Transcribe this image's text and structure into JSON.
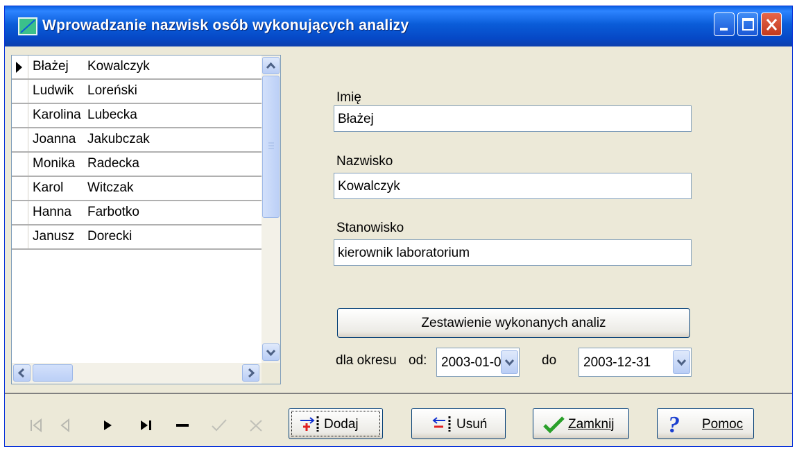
{
  "window": {
    "title": "Wprowadzanie nazwisk osób wykonujących analizy"
  },
  "grid": {
    "rows": [
      {
        "first": "Błażej",
        "last": "Kowalczyk",
        "current": true
      },
      {
        "first": "Ludwik",
        "last": "Loreński"
      },
      {
        "first": "Karolina",
        "last": "Lubecka"
      },
      {
        "first": "Joanna",
        "last": "Jakubczak"
      },
      {
        "first": "Monika",
        "last": "Radecka"
      },
      {
        "first": "Karol",
        "last": "Witczak"
      },
      {
        "first": "Hanna",
        "last": "Farbotko"
      },
      {
        "first": "Janusz",
        "last": "Dorecki"
      }
    ]
  },
  "form": {
    "first_name_label": "Imię",
    "first_name_value": "Błażej",
    "last_name_label": "Nazwisko",
    "last_name_value": "Kowalczyk",
    "position_label": "Stanowisko",
    "position_value": "kierownik laboratorium",
    "report_button": "Zestawienie wykonanych analiz",
    "period_label": "dla okresu",
    "from_label": "od:",
    "from_value": "2003-01-0",
    "to_label": "do",
    "to_value": "2003-12-31"
  },
  "navigator": [
    "first-icon",
    "prior-icon",
    "next-icon",
    "last-icon",
    "delete-icon",
    "post-icon",
    "cancel-icon"
  ],
  "buttons": {
    "add": "Dodaj",
    "delete": "Usuń",
    "close": "Zamknij",
    "help": "Pomoc"
  },
  "colors": {
    "titlebar": "#0a5cd8",
    "client": "#ece9d8"
  }
}
